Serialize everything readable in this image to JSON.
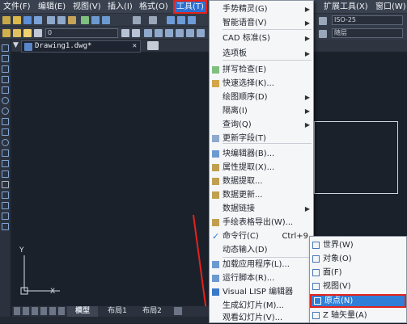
{
  "menubar": {
    "items": [
      "文件(F)",
      "编辑(E)",
      "视图(V)",
      "插入(I)",
      "格式(O)",
      "工具(T)",
      "扩展工具(X)",
      "窗口(W)"
    ]
  },
  "toolbar": {
    "combo_zero": "0",
    "combo_iso": "ISO-25",
    "combo_layer": "随层"
  },
  "document": {
    "tab_title": "Drawing1.dwg*"
  },
  "canvas": {
    "ucs_y": "Y",
    "ucs_x": "X"
  },
  "layout_tabs": [
    "模型",
    "布局1",
    "布局2"
  ],
  "tools_menu": {
    "items": [
      {
        "label": "手势精灵(G)",
        "sub": true
      },
      {
        "label": "智能语音(V)",
        "sub": true
      },
      {
        "label": "CAD 标准(S)",
        "sub": true
      },
      {
        "label": "选项板",
        "sub": true
      },
      {
        "label": "拼写检查(E)"
      },
      {
        "label": "快速选择(K)..."
      },
      {
        "label": "绘图顺序(D)",
        "sub": true
      },
      {
        "label": "隔离(I)",
        "sub": true
      },
      {
        "label": "查询(Q)",
        "sub": true
      },
      {
        "label": "更新字段(T)"
      },
      {
        "label": "块编辑器(B)..."
      },
      {
        "label": "属性提取(X)..."
      },
      {
        "label": "数据提取..."
      },
      {
        "label": "数据更新..."
      },
      {
        "label": "数据链接",
        "sub": true
      },
      {
        "label": "手绘表格导出(W)..."
      },
      {
        "label": "命令行(C)",
        "accel": "Ctrl+9"
      },
      {
        "label": "动态输入(D)"
      },
      {
        "label": "加载应用程序(L)..."
      },
      {
        "label": "运行脚本(R)..."
      },
      {
        "label": "Visual LISP 编辑器"
      },
      {
        "label": "生成幻灯片(M)..."
      },
      {
        "label": "观看幻灯片(V)..."
      }
    ]
  },
  "ucs_submenu": {
    "items": [
      "世界(W)",
      "对象(O)",
      "面(F)",
      "视图(V)",
      "原点(N)",
      "Z 轴矢量(A)"
    ]
  },
  "colors": {
    "accent": "#2f7fd8",
    "highlight_border": "#e3231b"
  }
}
